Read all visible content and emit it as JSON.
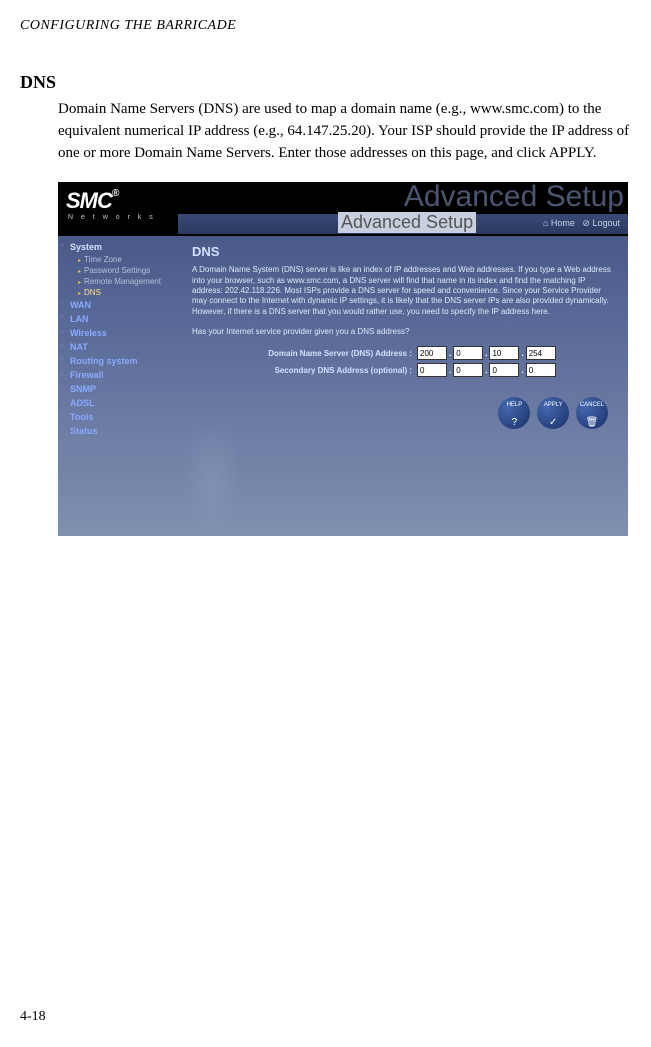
{
  "header": "CONFIGURING THE BARRICADE",
  "section_title": "DNS",
  "body": "Domain Name Servers (DNS) are used to map a domain name (e.g., www.smc.com) to the equivalent numerical IP address (e.g., 64.147.25.20). Your ISP should provide the IP address of one or more Domain Name Servers. Enter those addresses on this page, and click APPLY.",
  "page_number": "4-18",
  "screenshot": {
    "logo": "SMC",
    "logo_reg": "®",
    "logo_sub": "N e t w o r k s",
    "ghost": "Advanced Setup",
    "badge": "Advanced Setup",
    "home": "⌂ Home",
    "logout": "⊘ Logout",
    "sidebar": {
      "system": "System",
      "subs": [
        "Time Zone",
        "Password Settings",
        "Remote Management",
        "DNS"
      ],
      "items": [
        "WAN",
        "LAN",
        "Wireless",
        "NAT",
        "Routing system",
        "Firewall",
        "SNMP",
        "ADSL",
        "Tools",
        "Status"
      ]
    },
    "content": {
      "title": "DNS",
      "desc": "A Domain Name System (DNS) server is like an index of IP addresses and Web addresses. If you type a Web address into your browser, such as www.smc.com, a DNS server will find that name in its index and find the matching IP address: 202.42.118.226. Most ISPs provide a DNS server for speed and convenience. Since your Service Provider may connect to the Internet with dynamic IP settings, it is likely that the DNS server IPs are also provided dynamically. However, if there is a DNS server that you would rather use, you need to specify the IP address here.",
      "question": "Has your Internet service provider given you a DNS address?",
      "row1_label": "Domain Name Server (DNS) Address  :",
      "row2_label": "Secondary DNS Address (optional)  :",
      "ip1": [
        "200",
        "0",
        "10",
        "254"
      ],
      "ip2": [
        "0",
        "0",
        "0",
        "0"
      ],
      "buttons": [
        "HELP",
        "APPLY",
        "CANCEL"
      ],
      "button_icons": [
        "?",
        "✓",
        "🗑"
      ]
    }
  }
}
